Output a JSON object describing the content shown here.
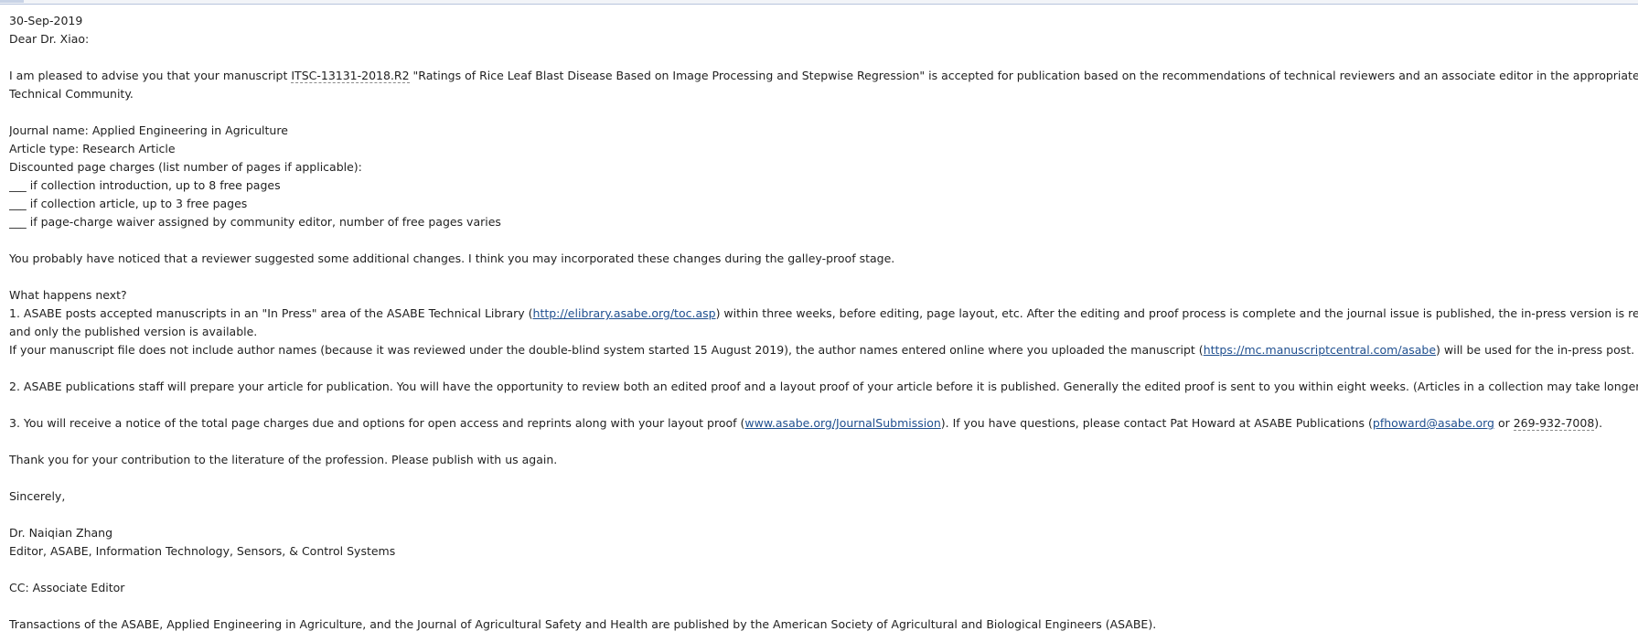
{
  "letter": {
    "date": "30-Sep-2019",
    "greeting": "Dear Dr. Xiao:",
    "p1": {
      "pre": "I am pleased to advise you that your manuscript ",
      "manuscript_id": "ITSC-13131-2018.R2",
      "post": " \"Ratings of Rice Leaf Blast Disease Based on Image Processing and Stepwise Regression\" is accepted for publication based on the recommendations of technical reviewers and an associate editor in the appropriate ASABE",
      "line2": "Technical Community."
    },
    "journal_name": "Journal name: Applied Engineering in Agriculture",
    "article_type": "Article type: Research Article",
    "discount_header": "Discounted page charges (list number of pages if applicable):",
    "discount_1": "___ if collection introduction, up to 8 free pages",
    "discount_2": "___ if collection article, up to 3 free pages",
    "discount_3": "___ if page-charge waiver assigned by community editor, number of free pages varies",
    "reviewer_note": "You probably have noticed that a reviewer suggested some additional changes. I think you may incorporated these changes during the galley-proof stage.",
    "next_header": "What happens next?",
    "step1": {
      "pre": "1. ASABE posts accepted manuscripts in an \"In Press\" area of the ASABE Technical Library (",
      "link": "http://elibrary.asabe.org/toc.asp",
      "post": ") within three weeks, before editing, page layout, etc. After the editing and proof process is complete and the journal issue is published, the in-press version is removed",
      "line2": "and only the published version is available.",
      "line3_pre": "If your manuscript file does not include author names (because it was reviewed under the double-blind system started 15 August 2019), the author names entered online where you uploaded the manuscript (",
      "line3_link": "https://mc.manuscriptcentral.com/asabe",
      "line3_post": ") will be used for the in-press post."
    },
    "step2": "2. ASABE publications staff will prepare your article for publication. You will have the opportunity to review both an edited proof and a layout proof of your article before it is published. Generally the edited proof is sent to you within eight weeks. (Articles in a collection may take longer.)",
    "step3": {
      "pre": "3. You will receive a notice of the total page charges due and options for open access and reprints along with your layout proof (",
      "link": "www.asabe.org/JournalSubmission",
      "mid": "). If you have questions, please contact Pat Howard at ASABE Publications (",
      "email": "pfhoward@asabe.org",
      "or": " or ",
      "phone": "269-932-7008",
      "end": ")."
    },
    "thanks": "Thank you for your contribution to the literature of the profession. Please publish with us again.",
    "closing": "Sincerely,",
    "signer_name": "Dr. Naiqian Zhang",
    "signer_title": "Editor, ASABE, Information Technology, Sensors, & Control Systems",
    "cc": "CC: Associate Editor",
    "footer": "Transactions of the ASABE, Applied Engineering in Agriculture, and the Journal of Agricultural Safety and Health are published by the American Society of Agricultural and Biological Engineers (ASABE)."
  }
}
